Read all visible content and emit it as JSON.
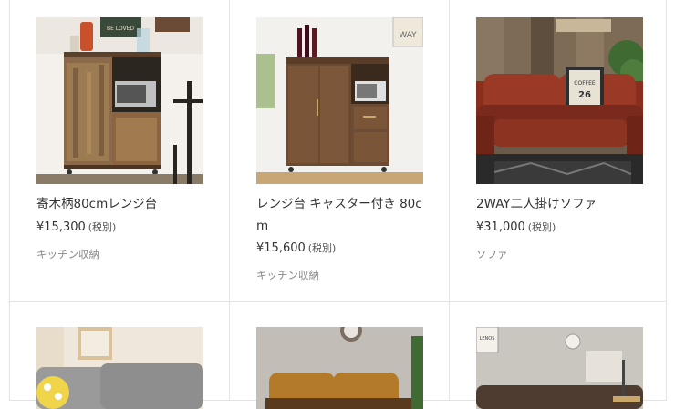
{
  "products": [
    {
      "name": "寄木柄80cmレンジ台",
      "price": "¥15,300",
      "tax": "(税別)",
      "category": "キッチン収納"
    },
    {
      "name": "レンジ台 キャスター付き 80cm",
      "price": "¥15,600",
      "tax": "(税別)",
      "category": "キッチン収納"
    },
    {
      "name": "2WAY二人掛けソファ",
      "price": "¥31,000",
      "tax": "(税別)",
      "category": "ソファ"
    }
  ],
  "decor": {
    "sign_love": "BE LOVED",
    "sign_way": "WAY",
    "pillow_text": "COFFEE",
    "pillow_num": "26",
    "poster_text": "LENOS"
  }
}
